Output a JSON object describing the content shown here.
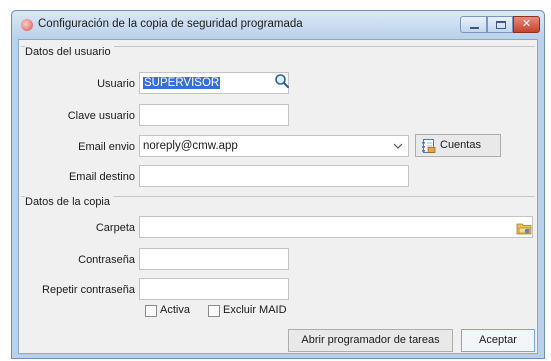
{
  "window": {
    "title": "Configuración de la copia de seguridad programada"
  },
  "user_group": {
    "title": "Datos del usuario",
    "usuario_label": "Usuario",
    "usuario_value": "SUPERVISOR",
    "clave_label": "Clave usuario",
    "clave_value": "",
    "email_envio_label": "Email envio",
    "email_envio_value": "noreply@cmw.app",
    "cuentas_label": "Cuentas",
    "email_destino_label": "Email destino",
    "email_destino_value": ""
  },
  "copy_group": {
    "title": "Datos de la copia",
    "carpeta_label": "Carpeta",
    "carpeta_value": "",
    "contrasena_label": "Contraseña",
    "contrasena_value": "",
    "repetir_label": "Repetir contraseña",
    "repetir_value": "",
    "activa_label": "Activa",
    "activa_checked": false,
    "excluir_label": "Excluir MAID",
    "excluir_checked": false
  },
  "footer": {
    "programador_label": "Abrir programador de tareas",
    "aceptar_label": "Aceptar"
  },
  "icons": {
    "app": "app-icon",
    "search": "magnifier-icon",
    "dropdown": "chevron-down-icon",
    "accounts": "address-book-icon",
    "folder": "folder-icon"
  },
  "colors": {
    "title_bar": "#b9d1ea",
    "close_button": "#c4432f",
    "selection": "#3470d8"
  }
}
